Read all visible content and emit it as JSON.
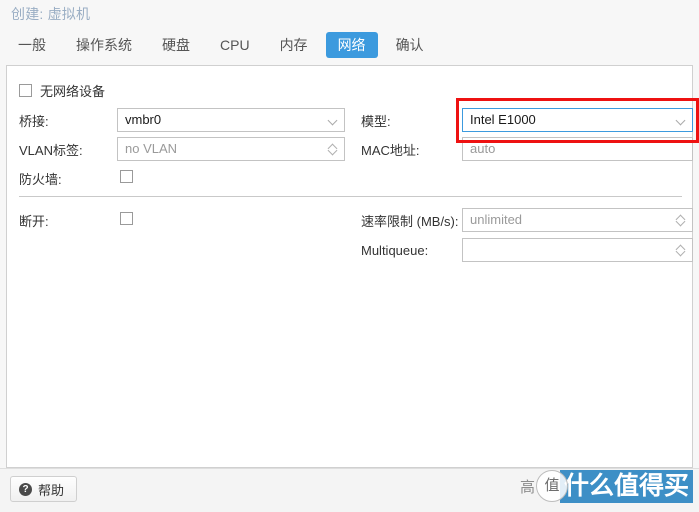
{
  "window": {
    "title": "创建: 虚拟机"
  },
  "tabs": [
    {
      "label": "一般",
      "active": false
    },
    {
      "label": "操作系统",
      "active": false
    },
    {
      "label": "硬盘",
      "active": false
    },
    {
      "label": "CPU",
      "active": false
    },
    {
      "label": "内存",
      "active": false
    },
    {
      "label": "网络",
      "active": true
    },
    {
      "label": "确认",
      "active": false
    }
  ],
  "form": {
    "no_network_device": {
      "label": "无网络设备",
      "checked": false
    },
    "bridge": {
      "label": "桥接:",
      "value": "vmbr0",
      "icon": "chevron-down-icon"
    },
    "vlan_tag": {
      "label": "VLAN标签:",
      "value": "no VLAN",
      "is_placeholder": true,
      "icon": "spinner-icon"
    },
    "firewall": {
      "label": "防火墙:",
      "checked": false
    },
    "disconnect": {
      "label": "断开:",
      "checked": false
    },
    "model": {
      "label": "模型:",
      "value": "Intel E1000",
      "focused": true,
      "highlighted": true,
      "icon": "chevron-down-icon"
    },
    "mac_address": {
      "label": "MAC地址:",
      "value": "auto",
      "is_placeholder": true
    },
    "rate_limit": {
      "label": "速率限制 (MB/s):",
      "value": "unlimited",
      "is_placeholder": true,
      "icon": "spinner-icon"
    },
    "multiqueue": {
      "label": "Multiqueue:",
      "value": "",
      "is_placeholder": true,
      "icon": "spinner-icon"
    }
  },
  "footer": {
    "help_label": "帮助",
    "help_icon": "question-mark-circle-icon"
  },
  "watermark": {
    "logo_text": "高",
    "logo_badge": "值",
    "brand": "什么值得买"
  },
  "colors": {
    "accent": "#3c9ade",
    "annotation": "#ee1111",
    "title": "#9aaec4",
    "watermark_blue": "#3d8fc6"
  }
}
